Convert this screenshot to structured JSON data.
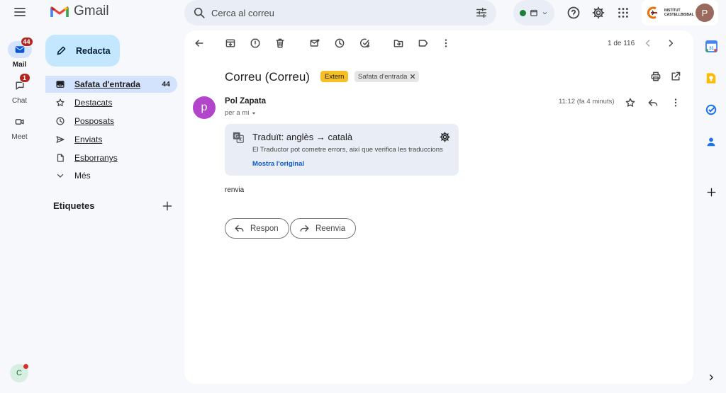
{
  "app": {
    "name": "Gmail"
  },
  "search": {
    "placeholder": "Cerca al correu"
  },
  "rail": {
    "mail_label": "Mail",
    "mail_badge": "44",
    "chat_label": "Chat",
    "chat_badge": "1",
    "meet_label": "Meet",
    "profile_initial": "C"
  },
  "account": {
    "org_name": "INSTITUT CASTELLBISBAL",
    "avatar_initial": "P"
  },
  "compose": {
    "label": "Redacta"
  },
  "nav": {
    "items": [
      {
        "label": "Safata d'entrada",
        "count": "44",
        "icon": "inbox-icon"
      },
      {
        "label": "Destacats",
        "count": "",
        "icon": "star-icon"
      },
      {
        "label": "Posposats",
        "count": "",
        "icon": "clock-icon"
      },
      {
        "label": "Enviats",
        "count": "",
        "icon": "send-icon"
      },
      {
        "label": "Esborranys",
        "count": "",
        "icon": "draft-icon"
      },
      {
        "label": "Més",
        "count": "",
        "icon": "chevron-down-icon"
      }
    ],
    "labels_title": "Etiquetes"
  },
  "toolbar": {
    "pager": "1 de 116"
  },
  "email": {
    "subject": "Correu (Correu)",
    "badge_external": "Extern",
    "badge_folder": "Safata d'entrada",
    "sender_initial": "p",
    "sender_name": "Pol Zapata",
    "recipient": "per a mi",
    "time": "11:12 (fa 4 minuts)",
    "body": "renvia"
  },
  "translation": {
    "title": "Traduït: anglès → català",
    "disclaimer": "El Traductor pot cometre errors, així que verifica les traduccions",
    "show_original": "Mostra l'original"
  },
  "actions": {
    "reply": "Respon",
    "forward": "Reenvia"
  },
  "colors": {
    "accent": "#0b57d0",
    "compose_bg": "#c2e7ff",
    "nav_active_bg": "#d3e3fd",
    "external_badge": "#f6bf26",
    "sender_avatar": "#b245c9",
    "badge_red": "#b3261e"
  }
}
